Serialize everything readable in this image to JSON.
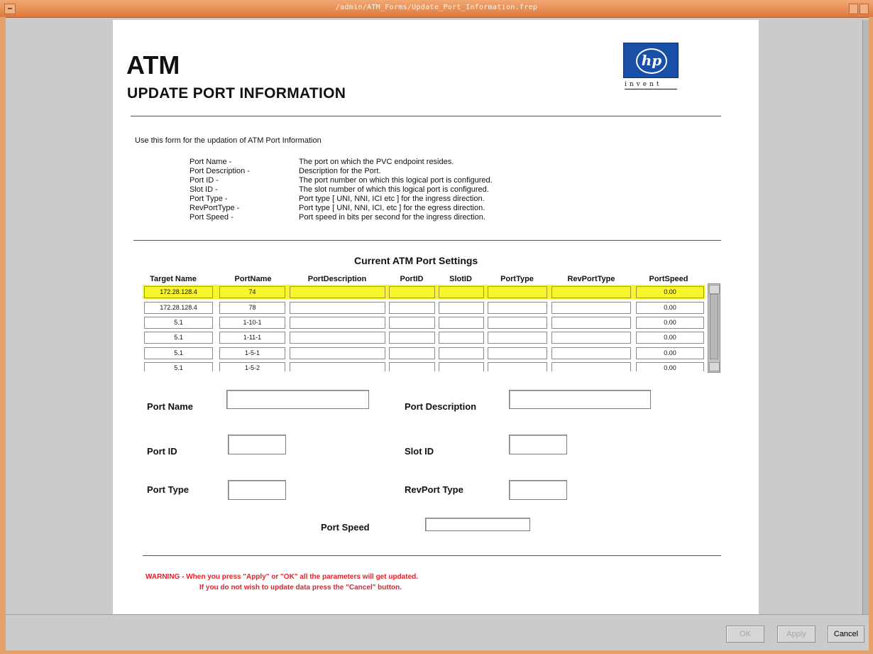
{
  "window": {
    "title": "/admin/ATM_Forms/Update_Port_Information.frep"
  },
  "header": {
    "app": "ATM",
    "title": "UPDATE PORT INFORMATION",
    "logo_mark": "hp",
    "logo_tagline": "invent"
  },
  "intro": "Use this form for the updation of ATM Port Information",
  "definitions": [
    {
      "term": "Port Name -",
      "desc": "The port on which the PVC endpoint resides."
    },
    {
      "term": "Port Description -",
      "desc": "Description for the Port."
    },
    {
      "term": "Port ID -",
      "desc": "The port number on which this logical port is configured."
    },
    {
      "term": "Slot ID -",
      "desc": "The slot number of which this logical port is configured."
    },
    {
      "term": "Port Type -",
      "desc": "Port type [ UNI, NNI, ICI  etc ] for the ingress direction."
    },
    {
      "term": "RevPortType -",
      "desc": "Port type [ UNI, NNI, ICI, etc ] for the egress direction."
    },
    {
      "term": "Port Speed -",
      "desc": "Port speed in bits per second for the ingress direction."
    }
  ],
  "table": {
    "caption": "Current ATM Port Settings",
    "columns": [
      "Target Name",
      "PortName",
      "PortDescription",
      "PortID",
      "SlotID",
      "PortType",
      "RevPortType",
      "PortSpeed"
    ],
    "rows": [
      [
        "172.28.128.4",
        "74",
        "",
        "",
        "",
        "",
        "",
        "0.00"
      ],
      [
        "172.28.128.4",
        "78",
        "",
        "",
        "",
        "",
        "",
        "0.00"
      ],
      [
        "5.1",
        "1-10-1",
        "",
        "",
        "",
        "",
        "",
        "0.00"
      ],
      [
        "5.1",
        "1-11-1",
        "",
        "",
        "",
        "",
        "",
        "0.00"
      ],
      [
        "5.1",
        "1-5-1",
        "",
        "",
        "",
        "",
        "",
        "0.00"
      ],
      [
        "5.1",
        "1-5-2",
        "",
        "",
        "",
        "",
        "",
        "0.00"
      ]
    ],
    "selected_row": 0,
    "highlight_color": "#f6f52e"
  },
  "form": {
    "port_name_label": "Port Name",
    "port_name_value": "",
    "port_description_label": "Port Description",
    "port_description_value": "",
    "port_id_label": "Port ID",
    "port_id_value": "",
    "slot_id_label": "Slot ID",
    "slot_id_value": "",
    "port_type_label": "Port Type",
    "port_type_value": "",
    "rev_port_type_label": "RevPort Type",
    "rev_port_type_value": "",
    "port_speed_label": "Port Speed",
    "port_speed_value": ""
  },
  "warning": {
    "line1": "WARNING -    When you press \"Apply\" or \"OK\" all the parameters will get updated.",
    "line2": "If you do not wish to update data press the \"Cancel\" button.",
    "color": "#e0242b"
  },
  "buttons": {
    "ok": "OK",
    "apply": "Apply",
    "cancel": "Cancel"
  }
}
